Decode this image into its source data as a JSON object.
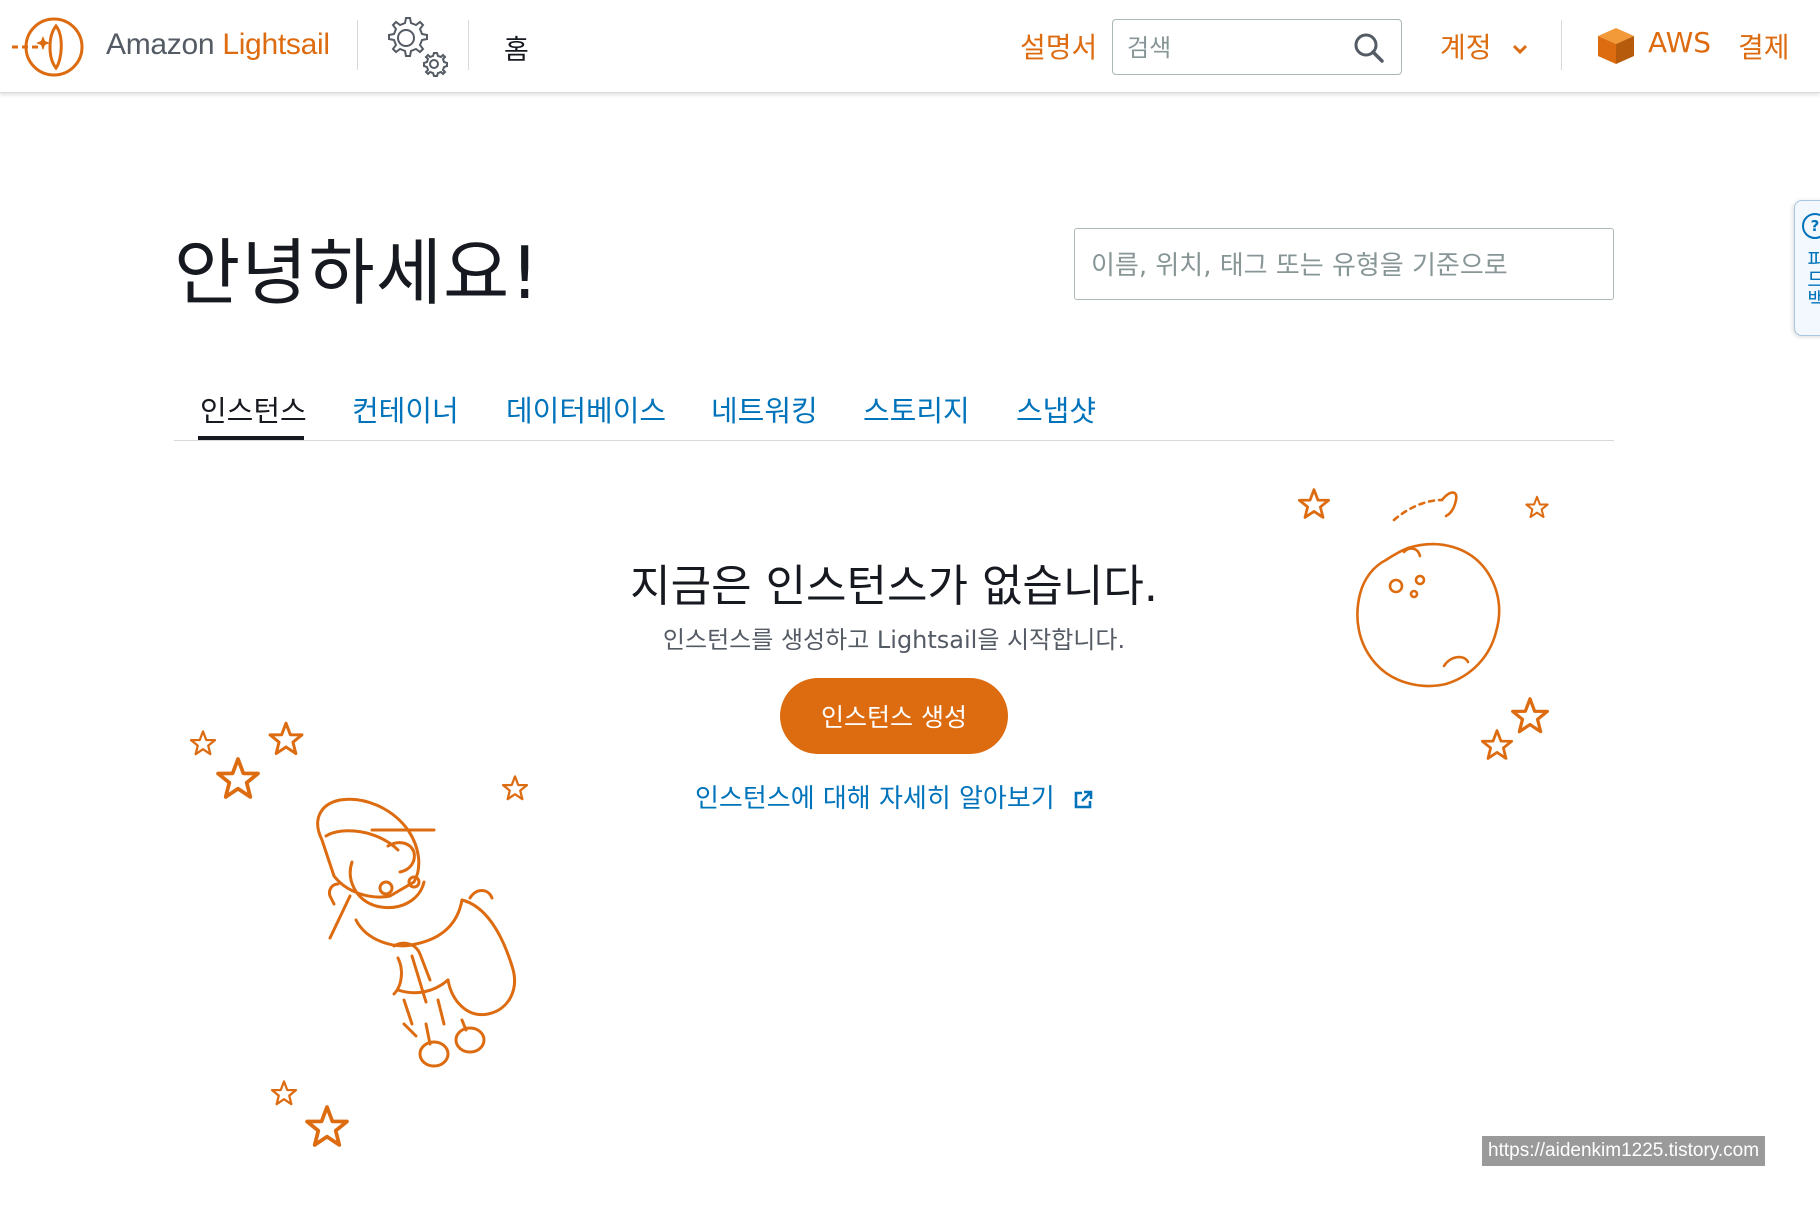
{
  "header": {
    "brand_prefix": "Amazon",
    "brand_name": "Lightsail",
    "home_label": "홈",
    "docs_label": "설명서",
    "search_placeholder": "검색",
    "account_label": "계정",
    "aws_label": "AWS",
    "billing_label": "결제"
  },
  "feedback": {
    "label": "피드백"
  },
  "main": {
    "greeting": "안녕하세요!",
    "resource_search_placeholder": "이름, 위치, 태그 또는 유형을 기준으로"
  },
  "tabs": [
    {
      "label": "인스턴스",
      "active": true
    },
    {
      "label": "컨테이너"
    },
    {
      "label": "데이터베이스"
    },
    {
      "label": "네트워킹"
    },
    {
      "label": "스토리지"
    },
    {
      "label": "스냅샷"
    }
  ],
  "empty_state": {
    "title": "지금은 인스턴스가 없습니다.",
    "subtitle": "인스턴스를 생성하고 Lightsail을 시작합니다.",
    "create_button": "인스턴스 생성",
    "learn_more": "인스턴스에 대해 자세히 알아보기"
  },
  "colors": {
    "accent": "#dd6b10",
    "link": "#0073bb",
    "text": "#16191f",
    "border": "#d5dbdb"
  },
  "icons": [
    "lightsail-logo-icon",
    "settings-gear-icon",
    "search-icon",
    "chevron-down-icon",
    "aws-box-icon",
    "help-icon",
    "external-link-icon"
  ],
  "watermark": "https://aidenkim1225.tistory.com"
}
